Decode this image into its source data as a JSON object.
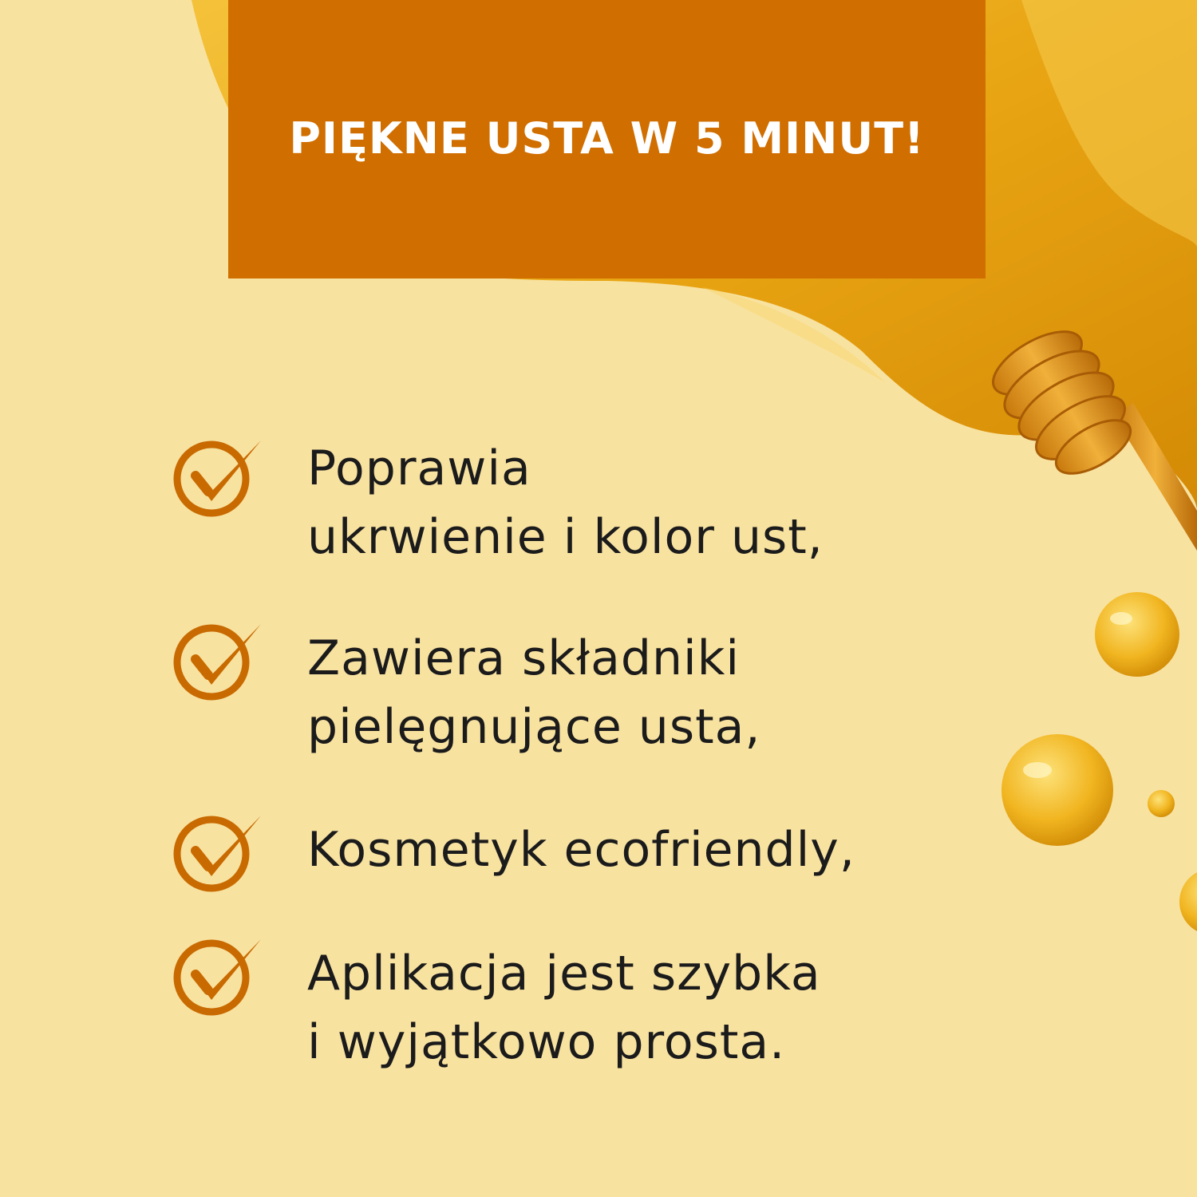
{
  "title": "PIĘKNE USTA W 5 MINUT!",
  "colors": {
    "background": "#f8e2a0",
    "title_box": "#d06e00",
    "check": "#c86a00",
    "honey": "#e8a412",
    "text": "#1b1b1b"
  },
  "benefits": [
    {
      "line1": "Poprawia",
      "line2": "ukrwienie i kolor ust,"
    },
    {
      "line1": "Zawiera składniki",
      "line2": "pielęgnujące usta,"
    },
    {
      "line1": "Kosmetyk ecofriendly,",
      "line2": ""
    },
    {
      "line1": "Aplikacja jest szybka",
      "line2": "i wyjątkowo prosta."
    }
  ],
  "icons": {
    "bullet": "circle-check-icon",
    "decoration": "honey-dipper-icon"
  }
}
